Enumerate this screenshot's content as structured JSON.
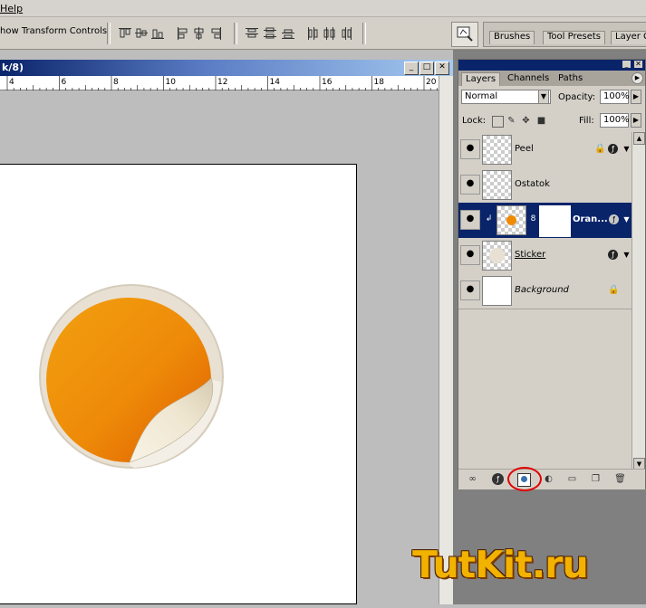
{
  "menu": {
    "help_label": "Help"
  },
  "options_bar": {
    "show_transform_controls": "how Transform Controls",
    "align_icons": [
      "align-top-edges-icon",
      "align-vertical-centers-icon",
      "align-bottom-edges-icon",
      "align-left-edges-icon",
      "align-horizontal-centers-icon",
      "align-right-edges-icon"
    ],
    "distribute_icons": [
      "distribute-top-icon",
      "distribute-center-icon",
      "distribute-bottom-icon",
      "distribute-left-icon",
      "distribute-hcenter-icon",
      "distribute-right-icon"
    ],
    "palette_tabs": [
      "Brushes",
      "Tool Presets",
      "Layer C"
    ]
  },
  "document": {
    "title": "k/8)",
    "ruler_labels": [
      "4",
      "6",
      "8",
      "10",
      "12",
      "14",
      "16",
      "18",
      "20"
    ]
  },
  "layers_panel": {
    "tabs": [
      "Layers",
      "Channels",
      "Paths"
    ],
    "blend_mode": "Normal",
    "opacity_label": "Opacity:",
    "opacity_value": "100%",
    "lock_label": "Lock:",
    "fill_label": "Fill:",
    "fill_value": "100%",
    "layers": [
      {
        "name": "Peel"
      },
      {
        "name": "Ostatok"
      },
      {
        "name": "Oran..."
      },
      {
        "name": "Sticker"
      },
      {
        "name": "Background"
      }
    ]
  },
  "watermark": {
    "text": "TutKit.ru"
  },
  "colors": {
    "accent": "#0a246a",
    "orange": "#f0900a",
    "highlight_circle": "#e00000"
  }
}
